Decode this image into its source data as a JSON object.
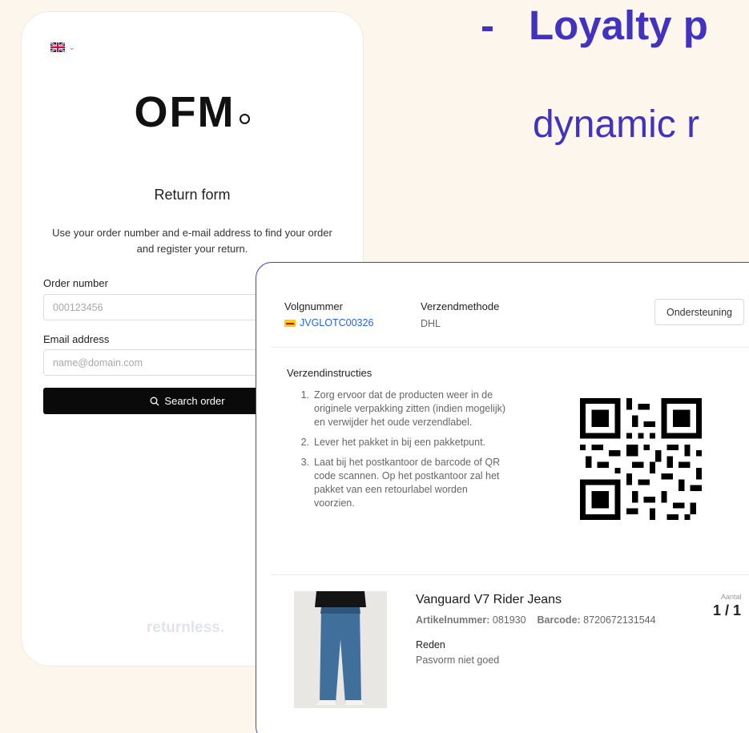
{
  "headline": {
    "line1": "Loyalty p",
    "line2": "dynamic r",
    "color": "#4133c0"
  },
  "return_form": {
    "language": {
      "flag": "uk-flag-icon"
    },
    "logo": "OFM",
    "title": "Return form",
    "description": "Use your order number and e-mail address to find your order and register your return.",
    "order_number": {
      "label": "Order number",
      "placeholder": "000123456",
      "value": ""
    },
    "email": {
      "label": "Email address",
      "placeholder": "name@domain.com",
      "value": ""
    },
    "search_button": {
      "label": "Search order",
      "icon": "search-icon"
    },
    "footer_brand": "returnless."
  },
  "shipment": {
    "tracking_label": "Volgnummer",
    "tracking_number": "JVGLOTC00326",
    "carrier_icon": "dhl-icon",
    "method_label": "Verzendmethode",
    "method_value": "DHL",
    "support_button": "Ondersteuning",
    "instructions_title": "Verzendinstructies",
    "instructions": [
      {
        "num": "1.",
        "text": "Zorg ervoor dat de producten weer in de originele verpakking zitten (indien mogelijk) en verwijder het oude verzendlabel."
      },
      {
        "num": "2.",
        "text": "Lever het pakket in bij een pakketpunt."
      },
      {
        "num": "3.",
        "text": "Laat bij het postkantoor de barcode of QR code scannen. Op het postkantoor zal het pakket van een retourlabel worden voorzien."
      }
    ],
    "product": {
      "name": "Vanguard V7 Rider Jeans",
      "article_label": "Artikelnummer:",
      "article_number": "081930",
      "barcode_label": "Barcode:",
      "barcode": "8720672131544",
      "reason_label": "Reden",
      "reason_value": "Pasvorm niet goed",
      "quantity_label": "Aantal",
      "quantity_value": "1 / 1"
    }
  }
}
